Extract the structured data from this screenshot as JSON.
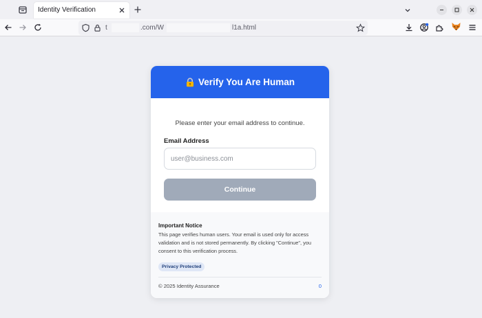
{
  "browser": {
    "tab_title": "Identity Verification",
    "url_part1": "t",
    "url_part2": ".com/W",
    "url_part3": "l1a.html"
  },
  "card": {
    "title": "Verify You Are Human",
    "instruction": "Please enter your email address to continue.",
    "email_label": "Email Address",
    "email_placeholder": "user@business.com",
    "email_value": "",
    "continue_label": "Continue",
    "header_color": "#2563eb",
    "button_color": "#a0aab9"
  },
  "notice": {
    "title": "Important Notice",
    "body": "This page verifies human users. Your email is used only for access validation and is not stored permanently. By clicking \"Continue\", you consent to this verification process.",
    "badge": "Privacy Protected"
  },
  "footer": {
    "copyright": "© 2025 Identity Assurance",
    "count": "0"
  },
  "icons": [
    "tab-list-icon",
    "close-icon",
    "plus-icon",
    "chevron-down-icon",
    "minimize-icon",
    "maximize-icon",
    "close-window-icon",
    "back-arrow-icon",
    "forward-arrow-icon",
    "reload-icon",
    "shield-icon",
    "lock-icon",
    "bookmark-star-icon",
    "download-icon",
    "account-icon",
    "extensions-icon",
    "fox-extension-icon",
    "menu-icon",
    "padlock-key-icon"
  ]
}
